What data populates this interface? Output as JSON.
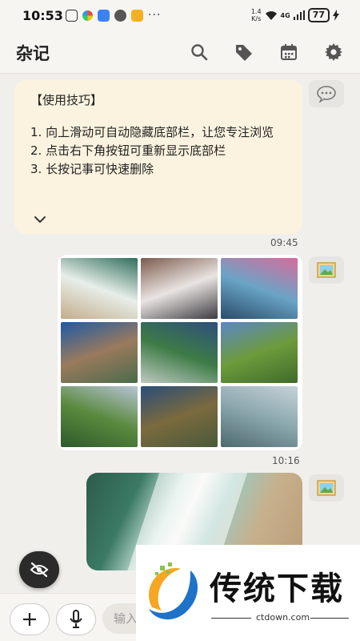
{
  "status_bar": {
    "time": "10:53",
    "speed": "1.4\nK/s",
    "signal_label": "4G",
    "battery": "77"
  },
  "app_bar": {
    "title": "杂记",
    "actions": [
      "search-icon",
      "tag-icon",
      "calendar-icon",
      "gear-icon"
    ]
  },
  "note": {
    "title": "【使用技巧】",
    "lines": [
      "1. 向上滑动可自动隐藏底部栏，让您专注浏览",
      "2. 点击右下角按钮可重新显示底部栏",
      "3. 长按记事可快速删除"
    ],
    "time": "09:45"
  },
  "gallery": {
    "time": "10:16",
    "images": [
      {
        "icon": "beach-aerial-image",
        "colors": [
          "#2f6e5c",
          "#e8eee9",
          "#c2ad8c"
        ]
      },
      {
        "icon": "snowy-mountain-image",
        "colors": [
          "#7d5b4e",
          "#e9e4e2",
          "#3c3b40"
        ]
      },
      {
        "icon": "cherry-blossom-lake-image",
        "colors": [
          "#d86b9c",
          "#6aa4c6",
          "#2a4c6b"
        ]
      },
      {
        "icon": "rock-valley-image",
        "colors": [
          "#1e5aa6",
          "#9a7a5d",
          "#4b6b4a"
        ]
      },
      {
        "icon": "island-church-image",
        "colors": [
          "#2e4f7c",
          "#3d7b46",
          "#bfc9c0"
        ]
      },
      {
        "icon": "waterfall-cliff-image",
        "colors": [
          "#5b86c8",
          "#6d9b3c",
          "#3f6b2b"
        ]
      },
      {
        "icon": "alpine-village-image",
        "colors": [
          "#b8c4d6",
          "#5a8a3e",
          "#2e5a2c"
        ]
      },
      {
        "icon": "coastal-peaks-image",
        "colors": [
          "#2a4d7a",
          "#7b6a3e",
          "#4a5a3a"
        ]
      },
      {
        "icon": "niagara-falls-image",
        "colors": [
          "#c7d3d9",
          "#8aa6ad",
          "#4d6a6f"
        ]
      }
    ]
  },
  "big_image": {
    "icon": "beach-aerial-image"
  },
  "bottom_bar": {
    "input_placeholder": "输入"
  },
  "watermark": {
    "text": "传统下载",
    "domain": "ctdown.com"
  },
  "colors": {
    "note_bg": "#fbf3df",
    "eye_button": "#2b2b2b",
    "accent_blue": "#1e73c8"
  }
}
